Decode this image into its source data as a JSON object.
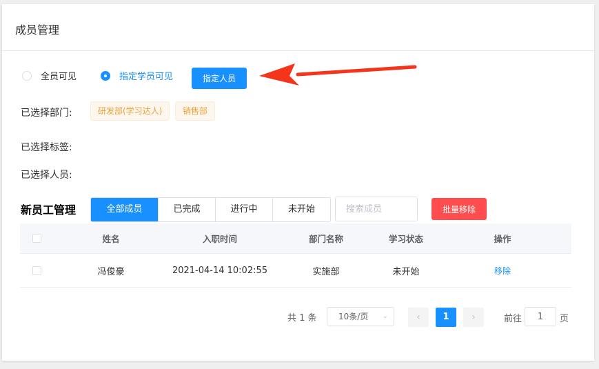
{
  "card": {
    "title": "成员管理"
  },
  "visibility": {
    "options": [
      {
        "label": "全员可见",
        "checked": false
      },
      {
        "label": "指定学员可见",
        "checked": true
      }
    ],
    "assign_button": "指定人员"
  },
  "selection": {
    "departments_label": "已选择部门:",
    "departments": [
      "研发部(学习达人)",
      "销售部"
    ],
    "tags_label": "已选择标签:",
    "people_label": "已选择人员:"
  },
  "staff": {
    "title": "新员工管理",
    "filters": [
      {
        "label": "全部成员",
        "active": true
      },
      {
        "label": "已完成",
        "active": false
      },
      {
        "label": "进行中",
        "active": false
      },
      {
        "label": "未开始",
        "active": false
      }
    ],
    "search_placeholder": "搜索成员",
    "batch_remove": "批量移除"
  },
  "table": {
    "columns": [
      "姓名",
      "入职时间",
      "部门名称",
      "学习状态",
      "操作"
    ],
    "rows": [
      {
        "name": "冯俊豪",
        "join_time": "2021-04-14 10:02:55",
        "department": "实施部",
        "status": "未开始",
        "action": "移除"
      }
    ]
  },
  "pagination": {
    "total": "共 1 条",
    "page_size": "10条/页",
    "current_page": "1",
    "goto_prefix": "前往",
    "goto_value": "1",
    "goto_suffix": "页"
  },
  "colors": {
    "primary": "#1890ff",
    "danger": "#ff4d4f",
    "tag_text": "#e6a23c",
    "arrow": "#f5341c"
  }
}
